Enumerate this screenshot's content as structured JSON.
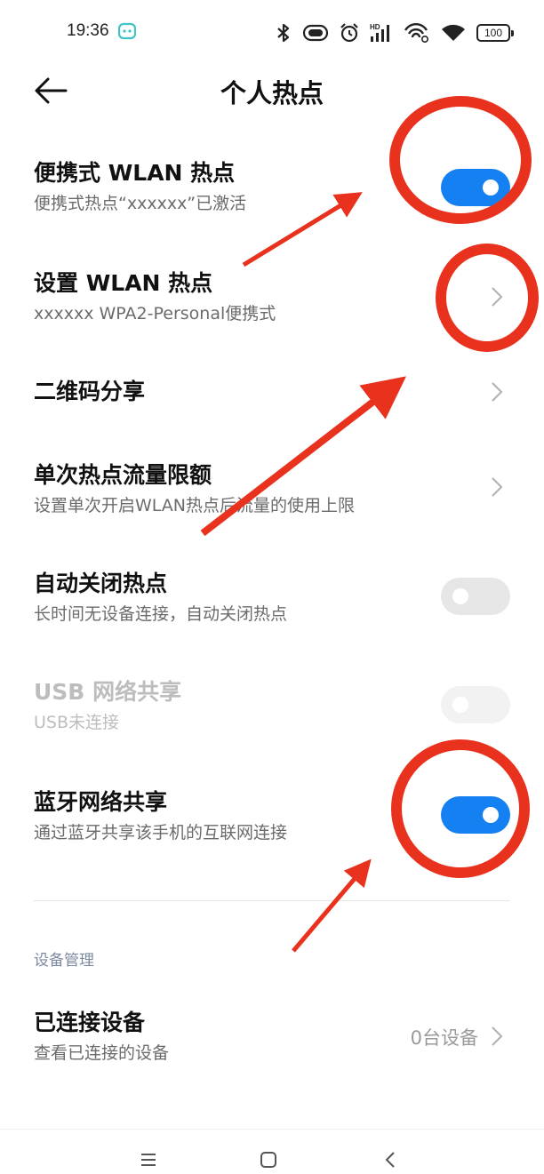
{
  "status_bar": {
    "time": "19:36",
    "battery": "100",
    "network_label": "HD",
    "icons": [
      "bluetooth-icon",
      "vibrate-icon",
      "alarm-icon",
      "signal-hd-icon",
      "wifi-call-icon",
      "wifi-icon",
      "battery-icon"
    ]
  },
  "header": {
    "title": "个人热点",
    "back_icon": "arrow-left-icon"
  },
  "settings": {
    "portable_hotspot": {
      "title": "便携式 WLAN 热点",
      "subtitle": "便携式热点“xxxxxx”已激活",
      "enabled": true
    },
    "setup_hotspot": {
      "title": "设置 WLAN 热点",
      "subtitle": "xxxxxx WPA2-Personal便携式"
    },
    "qr_share": {
      "title": "二维码分享"
    },
    "data_limit": {
      "title": "单次热点流量限额",
      "subtitle": "设置单次开启WLAN热点后流量的使用上限"
    },
    "auto_off": {
      "title": "自动关闭热点",
      "subtitle": "长时间无设备连接，自动关闭热点",
      "enabled": false
    },
    "usb_tether": {
      "title": "USB 网络共享",
      "subtitle": "USB未连接",
      "enabled": false,
      "disabled": true
    },
    "bt_tether": {
      "title": "蓝牙网络共享",
      "subtitle": "通过蓝牙共享该手机的互联网连接",
      "enabled": true
    }
  },
  "device_management": {
    "section_label": "设备管理",
    "connected": {
      "title": "已连接设备",
      "subtitle": "查看已连接的设备",
      "value": "0台设备"
    }
  },
  "nav_bar": {
    "icons": [
      "menu-icon",
      "home-icon",
      "back-icon"
    ]
  },
  "colors": {
    "accent": "#1580f2",
    "annotation": "#e8321e",
    "subtitle": "#6b6b6b",
    "section": "#7c8aa0"
  }
}
